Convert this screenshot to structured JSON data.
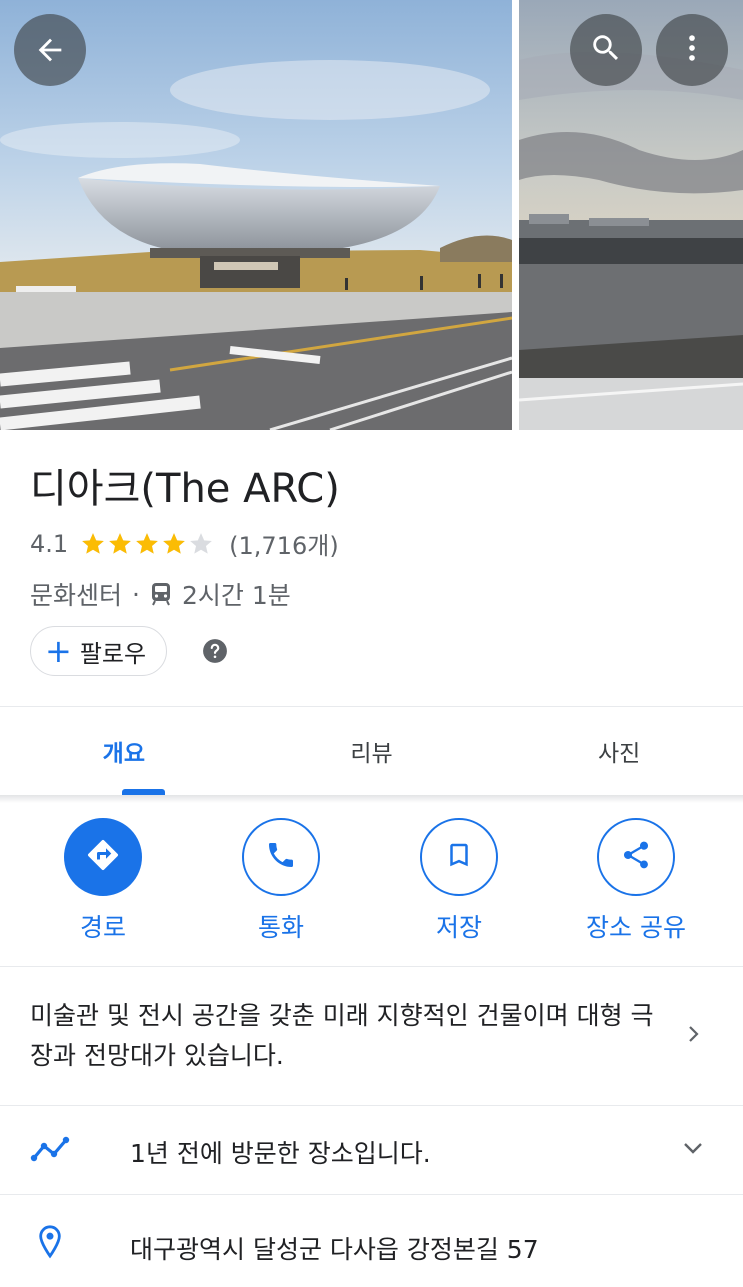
{
  "header": {
    "back_icon": "arrow-back-icon",
    "search_icon": "search-icon",
    "more_icon": "more-vert-icon"
  },
  "place": {
    "title": "디아크(The ARC)",
    "rating": "4.1",
    "rating_value": 4.1,
    "stars_max": 5,
    "review_count": "(1,716개)",
    "category": "문화센터",
    "separator": "·",
    "transit_time": "2시간 1분",
    "follow_label": "팔로우",
    "follow_plus": "+"
  },
  "tabs": [
    {
      "label": "개요",
      "active": true
    },
    {
      "label": "리뷰",
      "active": false
    },
    {
      "label": "사진",
      "active": false
    }
  ],
  "actions": [
    {
      "label": "경로",
      "icon": "directions-icon"
    },
    {
      "label": "통화",
      "icon": "phone-icon"
    },
    {
      "label": "저장",
      "icon": "bookmark-icon"
    },
    {
      "label": "장소 공유",
      "icon": "share-icon"
    }
  ],
  "description": "미술관 및 전시 공간을 갖춘 미래 지향적인 건물이며 대형 극장과 전망대가 있습니다.",
  "visit": {
    "text": "1년 전에 방문한 장소입니다.",
    "icon": "timeline-icon"
  },
  "address": {
    "text": "대구광역시 달성군 다사읍 강정본길 57",
    "icon": "location-pin-icon"
  },
  "colors": {
    "accent": "#1a73e8",
    "star": "#fbbc04",
    "star_empty": "#dadce0",
    "secondary_text": "#5f6368"
  }
}
